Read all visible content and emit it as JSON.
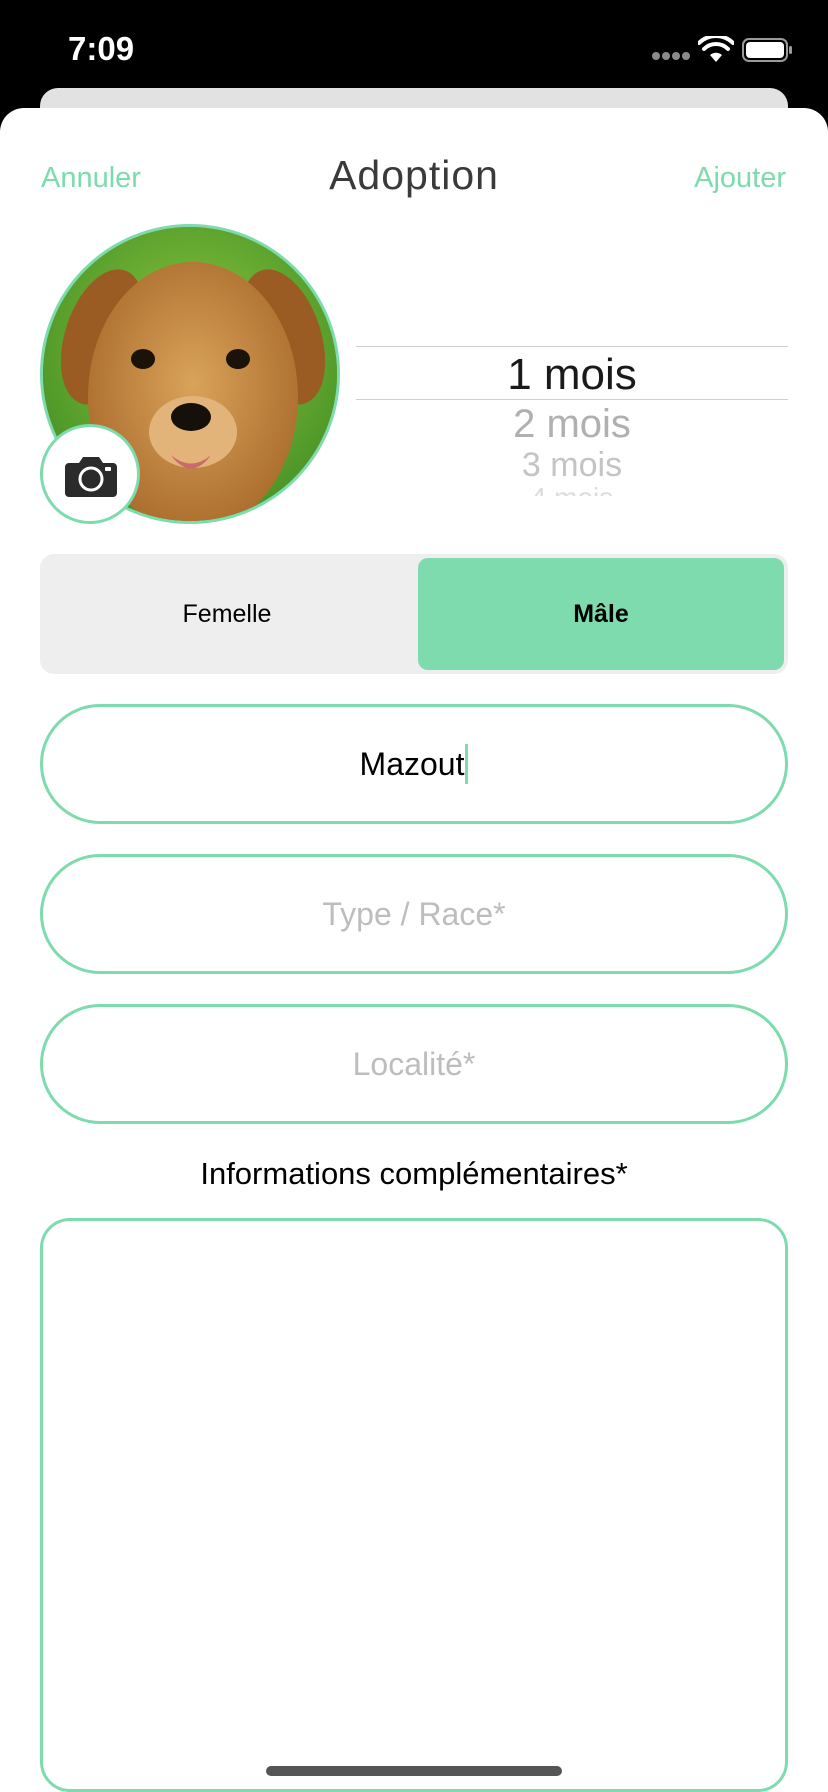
{
  "status_bar": {
    "time": "7:09"
  },
  "nav": {
    "cancel_label": "Annuler",
    "title": "Adoption",
    "add_label": "Ajouter"
  },
  "age_picker": {
    "selected": "1 mois",
    "options_below": [
      "2 mois",
      "3 mois",
      "4 mois"
    ]
  },
  "gender": {
    "options": [
      "Femelle",
      "Mâle"
    ],
    "selected": "Mâle"
  },
  "form": {
    "name_value": "Mazout",
    "type_placeholder": "Type / Race*",
    "location_placeholder": "Localité*",
    "info_label": "Informations complémentaires*",
    "info_value": ""
  },
  "colors": {
    "accent": "#7ddbae",
    "placeholder": "#bdbdbd",
    "segment_bg": "#eeeeee"
  }
}
